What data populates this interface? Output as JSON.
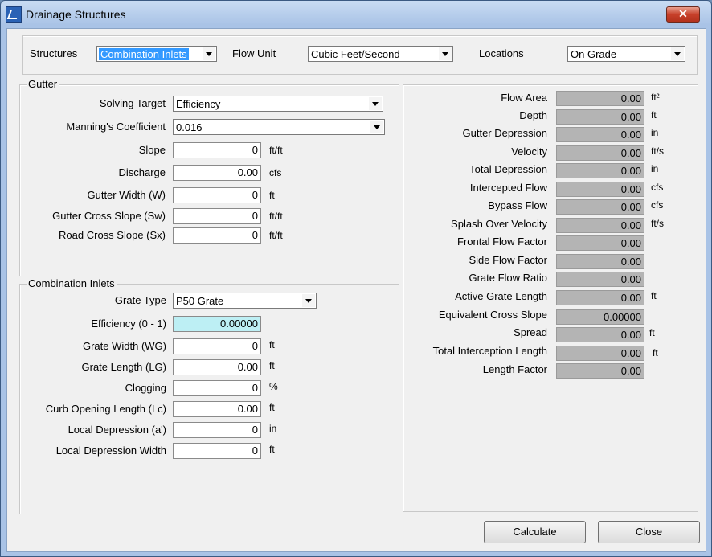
{
  "window": {
    "title": "Drainage Structures",
    "close_glyph": "✕"
  },
  "top": {
    "structures_label": "Structures",
    "structures_value": "Combination Inlets",
    "flow_unit_label": "Flow Unit",
    "flow_unit_value": "Cubic Feet/Second",
    "locations_label": "Locations",
    "locations_value": "On Grade"
  },
  "gutter": {
    "legend": "Gutter",
    "solving_target_label": "Solving Target",
    "solving_target_value": "Efficiency",
    "manning_label": "Manning's Coefficient",
    "manning_value": "0.016",
    "rows": [
      {
        "label": "Slope",
        "value": "0",
        "unit": "ft/ft"
      },
      {
        "label": "Discharge",
        "value": "0.00",
        "unit": "cfs"
      },
      {
        "label": "Gutter Width (W)",
        "value": "0",
        "unit": "ft"
      },
      {
        "label": "Gutter Cross Slope (Sw)",
        "value": "0",
        "unit": "ft/ft"
      },
      {
        "label": "Road Cross Slope (Sx)",
        "value": "0",
        "unit": "ft/ft"
      }
    ]
  },
  "inlets": {
    "legend": "Combination Inlets",
    "grate_type_label": "Grate Type",
    "grate_type_value": "P50 Grate",
    "rows": [
      {
        "label": "Efficiency (0 - 1)",
        "value": "0.00000",
        "unit": ""
      },
      {
        "label": "Grate Width (WG)",
        "value": "0",
        "unit": "ft"
      },
      {
        "label": "Grate Length (LG)",
        "value": "0.00",
        "unit": "ft"
      },
      {
        "label": "Clogging",
        "value": "0",
        "unit": "%"
      },
      {
        "label": "Curb Opening Length (Lc)",
        "value": "0.00",
        "unit": "ft"
      },
      {
        "label": "Local Depression (a')",
        "value": "0",
        "unit": "in"
      },
      {
        "label": "Local Depression Width",
        "value": "0",
        "unit": "ft"
      }
    ]
  },
  "results": [
    {
      "label": "Flow Area",
      "value": "0.00",
      "unit": "ft²"
    },
    {
      "label": "Depth",
      "value": "0.00",
      "unit": "ft"
    },
    {
      "label": "Gutter Depression",
      "value": "0.00",
      "unit": "in"
    },
    {
      "label": "Velocity",
      "value": "0.00",
      "unit": "ft/s"
    },
    {
      "label": "Total Depression",
      "value": "0.00",
      "unit": "in"
    },
    {
      "label": "Intercepted Flow",
      "value": "0.00",
      "unit": "cfs"
    },
    {
      "label": "Bypass Flow",
      "value": "0.00",
      "unit": "cfs"
    },
    {
      "label": "Splash Over Velocity",
      "value": "0.00",
      "unit": "ft/s"
    },
    {
      "label": "Frontal Flow Factor",
      "value": "0.00",
      "unit": ""
    },
    {
      "label": "Side Flow Factor",
      "value": "0.00",
      "unit": ""
    },
    {
      "label": "Grate Flow Ratio",
      "value": "0.00",
      "unit": ""
    },
    {
      "label": "Active Grate Length",
      "value": "0.00",
      "unit": "ft"
    },
    {
      "label": "Equivalent Cross Slope",
      "value": "0.00000",
      "unit": ""
    },
    {
      "label": "Spread",
      "value": "0.00",
      "unit": "ft"
    },
    {
      "label": "Total Interception Length",
      "value": "0.00",
      "unit": "ft"
    },
    {
      "label": "Length Factor",
      "value": "0.00",
      "unit": ""
    }
  ],
  "buttons": {
    "calculate": "Calculate",
    "close": "Close"
  }
}
